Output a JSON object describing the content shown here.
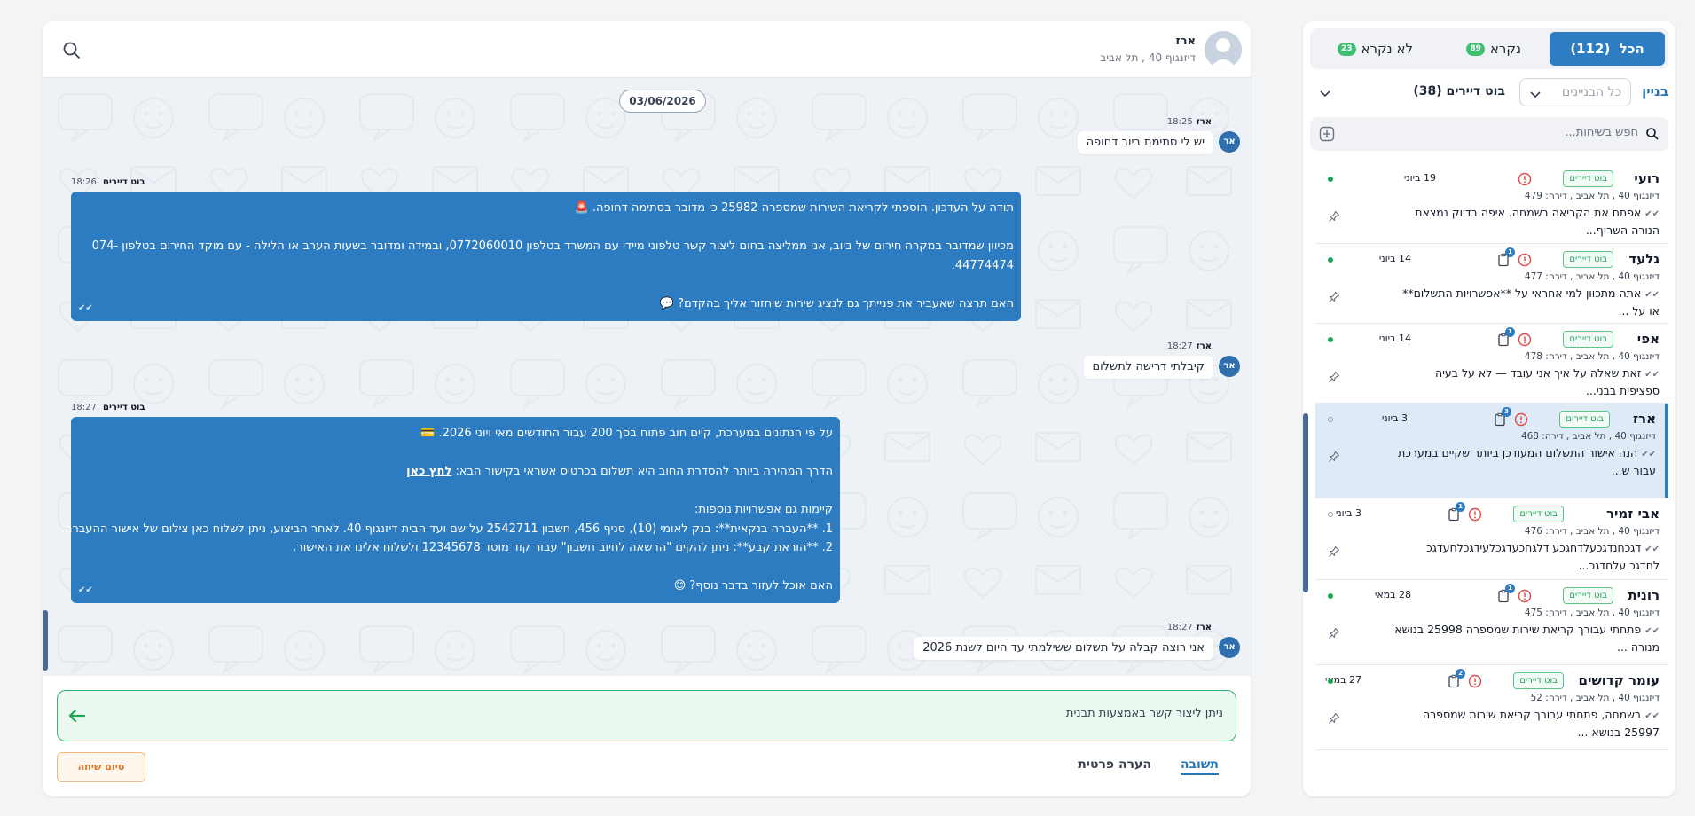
{
  "chat": {
    "header": {
      "name": "ארז",
      "address": "דיזנגוף 40 , תל אביב"
    },
    "date": "03/06/2026",
    "messages": [
      {
        "sender": "ארז",
        "time": "18:25",
        "avatar": "אר",
        "text": "יש לי סתימת ביוב דחופה"
      },
      {
        "sender": "בוט דיירים",
        "time": "18:26",
        "lines": [
          "תודה על העדכון. הוספתי לקריאת השירות שמספרה 25982 כי מדובר בסתימה דחופה. 🚨",
          "",
          "מכיוון שמדובר במקרה חירום של ביוב, אני ממליצה בחום ליצור קשר טלפוני מיידי עם המשרד בטלפון 0772060010, ובמידה ומדובר בשעות הערב או הלילה - עם מוקד החירום בטלפון 074-44774474.",
          "",
          "האם תרצה שאעביר את פנייתך גם לנציג שירות שיחזור אליך בהקדם? 💬"
        ]
      },
      {
        "sender": "ארז",
        "time": "18:27",
        "avatar": "אר",
        "text": "קיבלתי דרישה לתשלום"
      },
      {
        "sender": "בוט דיירים",
        "time": "18:27",
        "lines": [
          "על פי הנתונים במערכת, קיים חוב פתוח בסך 200 עבור החודשים מאי ויוני 2026. 💳",
          "",
          "הדרך המהירה ביותר להסדרת החוב היא תשלום בכרטיס אשראי בקישור הבא: ",
          "",
          "קיימות גם אפשרויות נוספות:",
          "1. **העברה בנקאית**: בנק לאומי (10), סניף 456, חשבון 2542711 על שם ועד הבית דיזנגוף 40. לאחר הביצוע, ניתן לשלוח כאן צילום של אישור ההעברה.",
          "2. **הוראת קבע**: ניתן להקים \"הרשאה לחיוב חשבון\" עבור קוד מוסד 12345678 ולשלוח אלינו את האישור.",
          "",
          "האם אוכל לעזור בדבר נוסף? 😊"
        ],
        "link": "לחץ כאן"
      },
      {
        "sender": "ארז",
        "time": "18:27",
        "avatar": "אר",
        "text": "אני רוצה קבלה על תשלום ששילמתי עד היום לשנת 2026"
      }
    ],
    "composer_text": "ניתן ליצור קשר באמצעות תבנית",
    "end_button": "סיום שיחה",
    "tabs": {
      "reply": "תשובה",
      "note": "הערה פרטית"
    }
  },
  "sidebar": {
    "filters": [
      {
        "label": "הכל",
        "count": "(112)",
        "active": true
      },
      {
        "label": "נקרא",
        "count": "89"
      },
      {
        "label": "לא נקרא",
        "count": "23"
      }
    ],
    "building_label": "בניין",
    "building_select": "כל הבניינים",
    "bot_select": "בוט דיירים (38)",
    "search_placeholder": "חפש בשיחות...",
    "conversations": [
      {
        "name": "רועי",
        "address": "דיזנגוף 40 , תל אביב , דירה: 479",
        "preview": "אפתח את הקריאה בשמחה. איפה בדיוק נמצאת הנורה השרוף...",
        "tag": "בוט דיירים",
        "date": "19 ביוני",
        "clip_badge": "",
        "unread": true
      },
      {
        "name": "גלעד",
        "address": "דיזנגוף 40 , תל אביב , דירה: 477",
        "preview": "אתה מתכוון למי אחראי על **אפשרויות התשלום** או על ...",
        "tag": "בוט דיירים",
        "date": "14 ביוני",
        "clip_badge": "1",
        "unread": true
      },
      {
        "name": "אפי",
        "address": "דיזנגוף 40 , תל אביב , דירה: 478",
        "preview": "זאת שאלה על איך אני עובד — לא על בעיה ספציפית בבני...",
        "tag": "בוט דיירים",
        "date": "14 ביוני",
        "clip_badge": "1",
        "unread": true
      },
      {
        "name": "ארז",
        "address": "דיזנגוף 40 , תל אביב , דירה: 468",
        "preview": "הנה אישור התשלום המעודכן ביותר שקיים במערכת עבור ש...",
        "tag": "בוט דיירים",
        "date": "3 ביוני",
        "clip_badge": "3",
        "unread": false,
        "selected": true
      },
      {
        "name": "אבי זמיר",
        "address": "דיזנגוף 40 , תל אביב , דירה: 476",
        "preview": "דגכחנדגכעלדחגכע דלגחכעדגכלעידגכלחעדגכ לחדגכ עלחדגכ...",
        "tag": "בוט דיירים",
        "date": "3 ביוני",
        "clip_badge": "1",
        "unread": false
      },
      {
        "name": "רונית",
        "address": "דיזנגוף 40 , תל אביב , דירה: 475",
        "preview": "פתחתי עבורך קריאת שירות שמספרה 25998 בנושא מנורה ...",
        "tag": "בוט דיירים",
        "date": "28 במאי",
        "clip_badge": "1",
        "unread": true
      },
      {
        "name": "עומר קדושים",
        "address": "דיזנגוף 40 , תל אביב , דירה: 52",
        "preview": "בשמחה, פתחתי עבורך קריאת שירות שמספרה 25997 בנושא ...",
        "tag": "בוט דיירים",
        "date": "27 במאי",
        "clip_badge": "2",
        "unread": true
      }
    ]
  },
  "colors": {
    "accent": "#2e7dc3",
    "bot_bubble": "#2d7cc1",
    "success": "#22a35a",
    "alert": "#e24a4a",
    "end_button": "#e0782b"
  },
  "icons": [
    "search-icon",
    "send-arrow-icon",
    "chevron-down-icon",
    "add-icon",
    "pin-icon",
    "alert-icon",
    "clipboard-icon",
    "avatar-icon"
  ]
}
